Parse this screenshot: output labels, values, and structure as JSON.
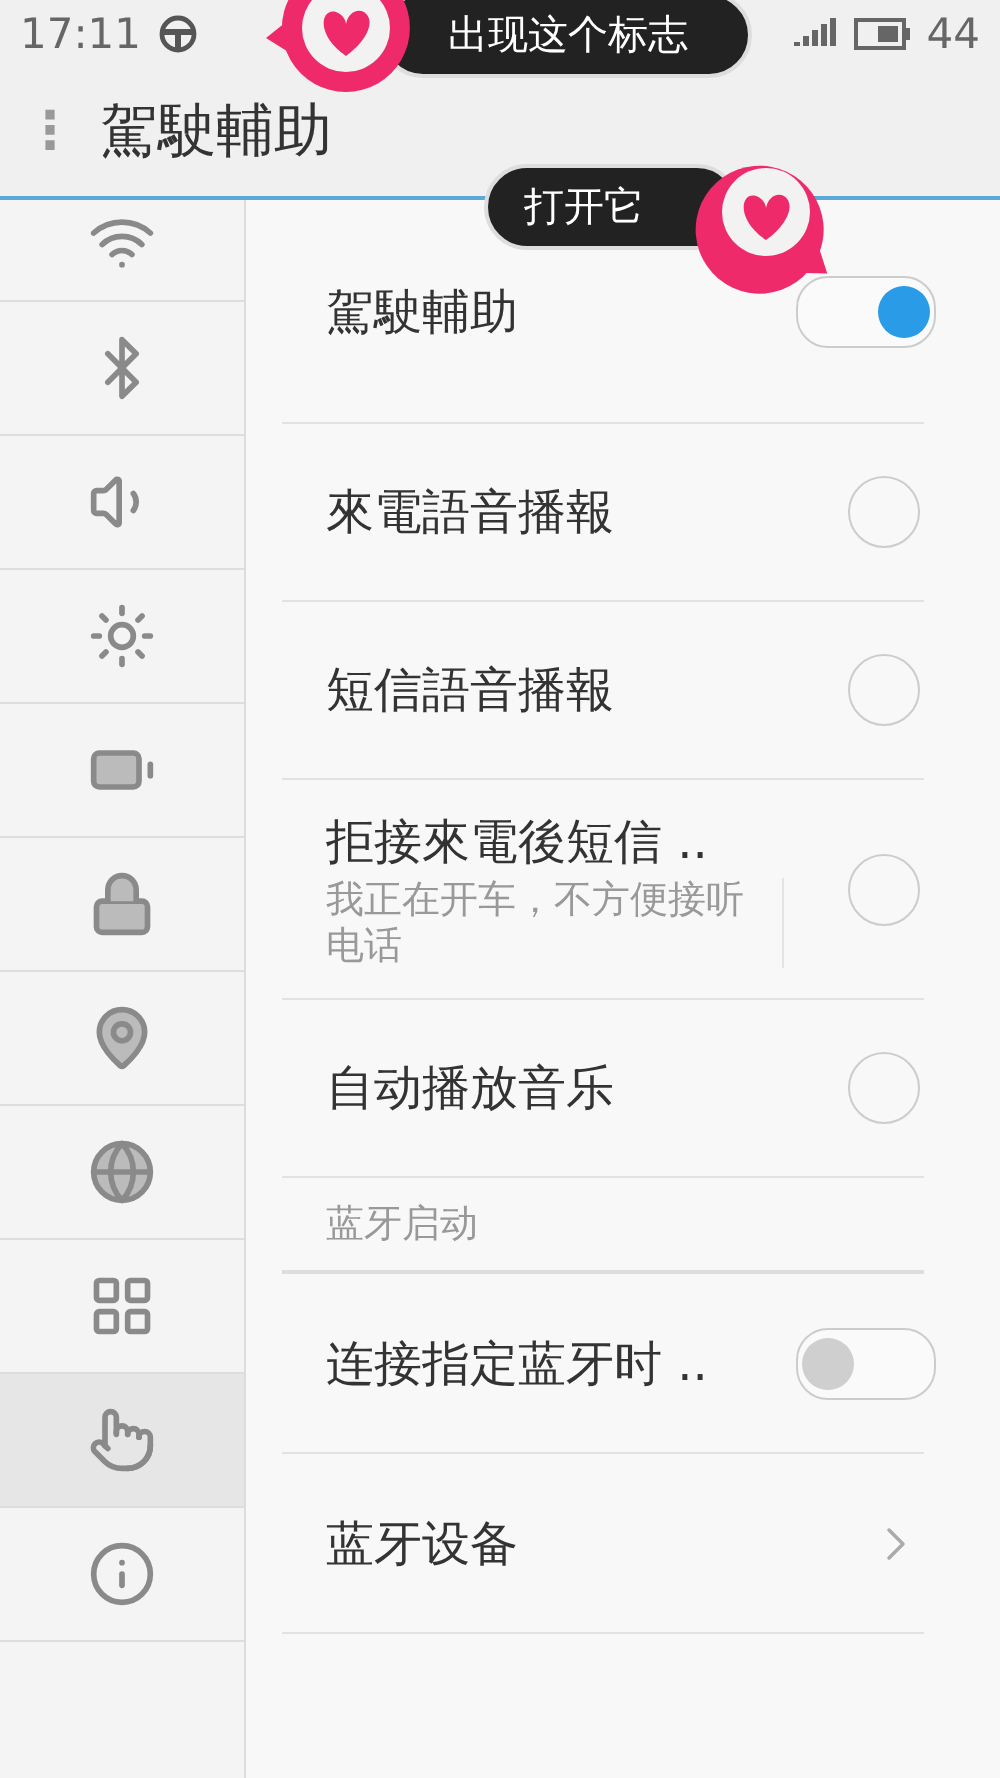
{
  "status_bar": {
    "time": "17:11",
    "battery": "44"
  },
  "header": {
    "menu_glyph": "⋮",
    "title": "駕駛輔助"
  },
  "sidebar": {
    "items": [
      {
        "selected": false
      },
      {
        "selected": false
      },
      {
        "selected": false
      },
      {
        "selected": false
      },
      {
        "selected": false
      },
      {
        "selected": false
      },
      {
        "selected": false
      },
      {
        "selected": false
      },
      {
        "selected": false
      },
      {
        "selected": true
      },
      {
        "selected": false
      }
    ]
  },
  "settings": [
    {
      "kind": "toggle",
      "title": "駕駛輔助",
      "on": true
    },
    {
      "kind": "radio",
      "title": "來電語音播報",
      "checked": false
    },
    {
      "kind": "radio",
      "title": "短信語音播報",
      "checked": false
    },
    {
      "kind": "radio",
      "title": "拒接來電後短信 ..",
      "subtitle": "我正在开车，不方便接听电话",
      "checked": false
    },
    {
      "kind": "radio",
      "title": "自动播放音乐",
      "checked": false
    },
    {
      "kind": "section",
      "title": "蓝牙启动"
    },
    {
      "kind": "toggle",
      "title": "连接指定蓝牙时 ..",
      "on": false
    },
    {
      "kind": "link",
      "title": "蓝牙设备"
    }
  ],
  "annotations": [
    {
      "text": "出现这个标志"
    },
    {
      "text": "打开它"
    }
  ]
}
